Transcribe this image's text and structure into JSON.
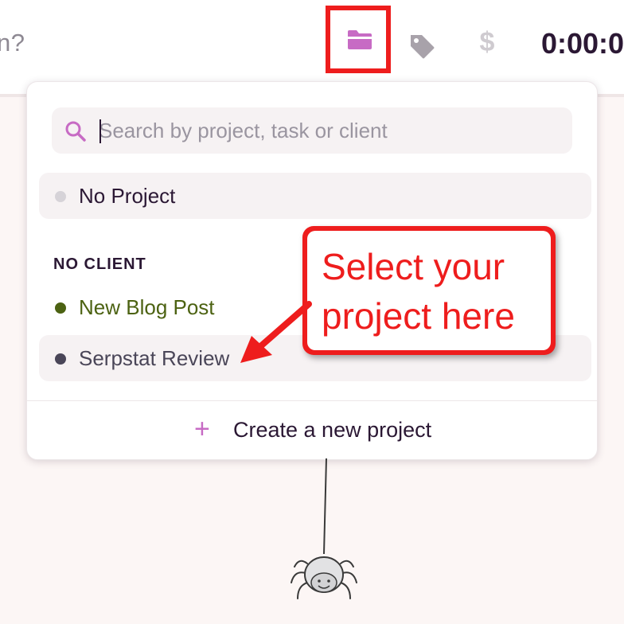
{
  "topbar": {
    "description_fragment": "n?",
    "timer": "0:00:0",
    "billable_symbol": "$"
  },
  "project_dropdown": {
    "search": {
      "placeholder": "Search by project, task or client"
    },
    "no_project_label": "No Project",
    "group_label": "NO CLIENT",
    "projects": [
      {
        "label": "New Blog Post",
        "color": "#4c6212"
      },
      {
        "label": "Serpstat Review",
        "color": "#4a4658"
      }
    ],
    "create_label": "Create a new project",
    "create_symbol": "+"
  },
  "annotation": {
    "line1": "Select your",
    "line2": "project here"
  },
  "colors": {
    "accent": "#c76bc4",
    "annotation_red": "#ee1d1d",
    "no_project_dot": "#d6d3d8"
  },
  "icons": [
    "folder-icon",
    "tag-icon",
    "dollar-icon",
    "search-icon",
    "plus-icon",
    "spider-icon"
  ]
}
